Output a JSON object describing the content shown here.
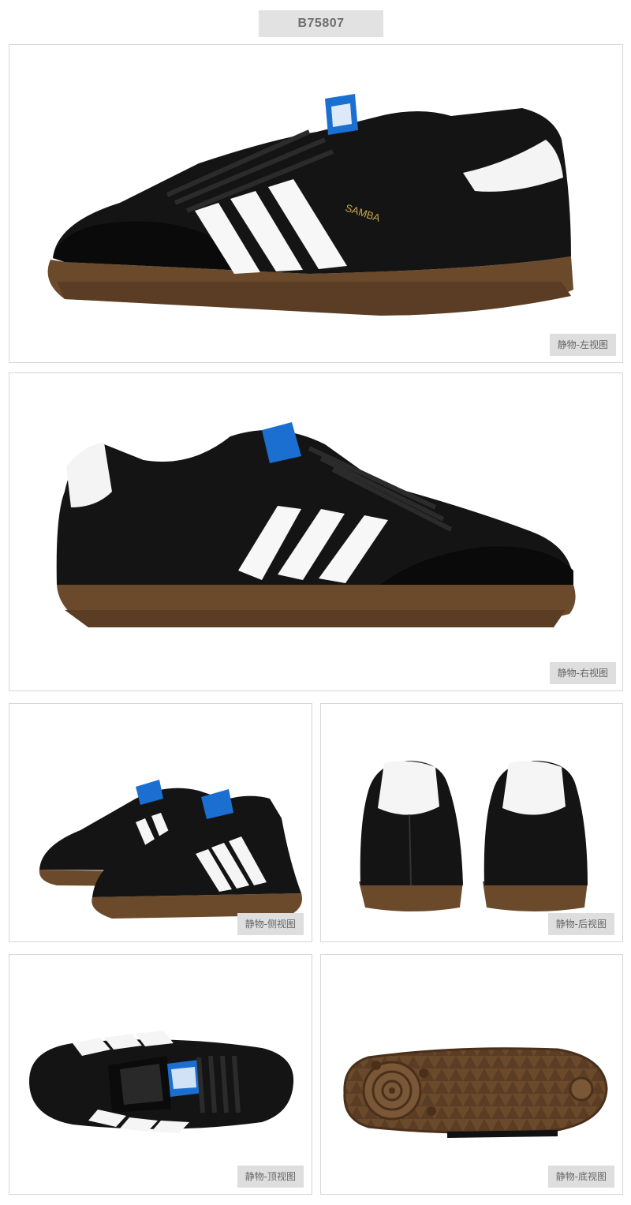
{
  "header": {
    "sku": "B75807"
  },
  "views": [
    {
      "label": "静物-左视图",
      "shoe_text": "SAMBA"
    },
    {
      "label": "静物-右视图"
    },
    {
      "label": "静物-侧视图"
    },
    {
      "label": "静物-后视图"
    },
    {
      "label": "静物-顶视图"
    },
    {
      "label": "静物-底视图"
    }
  ],
  "colors": {
    "leather": "#111111",
    "stripes": "#ffffff",
    "gum_sole": "#6b4a2c",
    "tongue_label": "#1b6fd1",
    "label_bg": "#dedede",
    "header_bg": "#e2e2e2"
  }
}
